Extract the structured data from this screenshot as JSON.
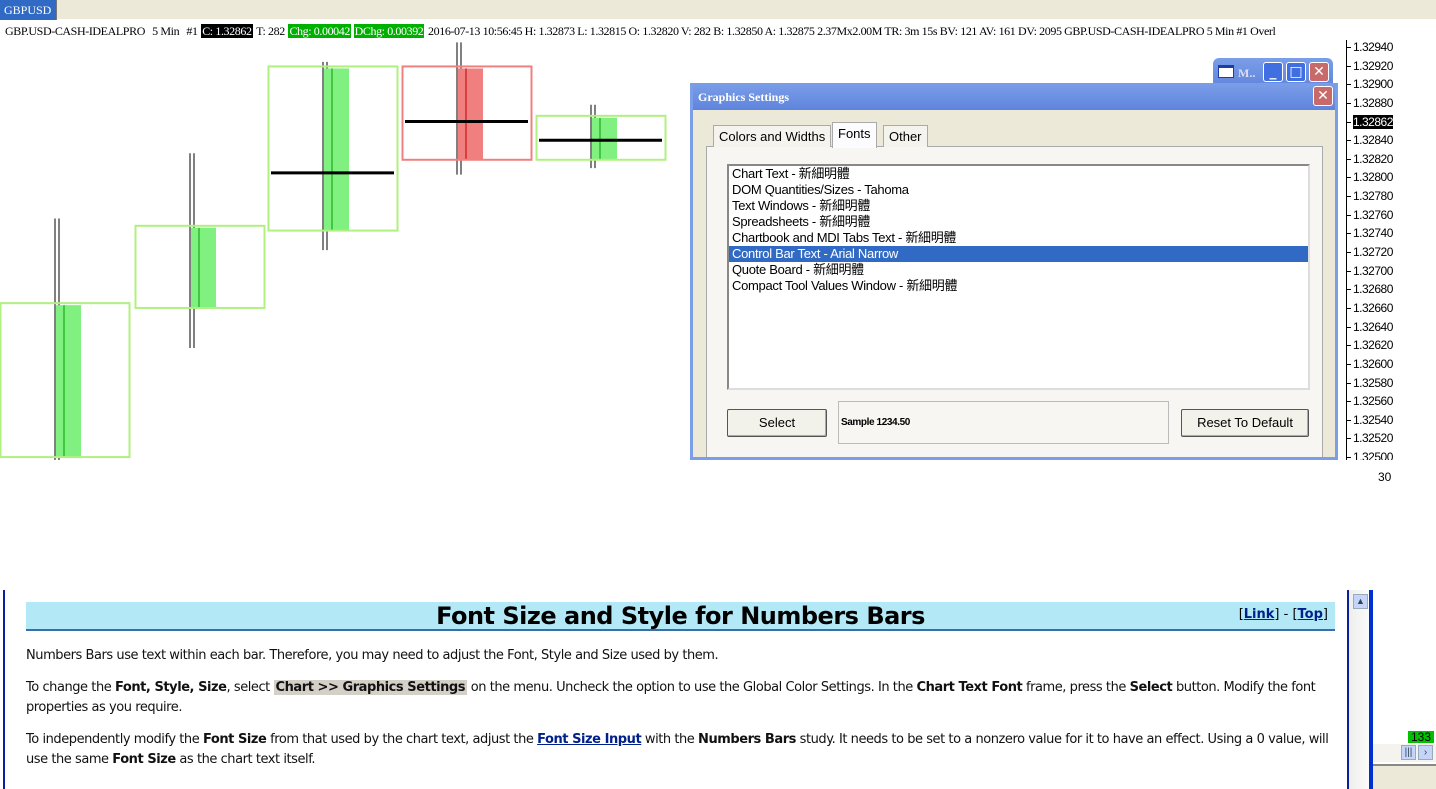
{
  "tab": {
    "label": "GBPUSD"
  },
  "info": {
    "symbol": "GBP.USD-CASH-IDEALPRO",
    "interval": "5 Min",
    "num": "#1",
    "close": "C: 1.32862",
    "ticks": "T: 282",
    "chg": "Chg: 0.00042",
    "dchg": "DChg: 0.00392",
    "rest": "2016-07-13 10:56:45 H: 1.32873 L: 1.32815 O: 1.32820 V: 282 B: 1.32850 A: 1.32875 2.37Mx2.00M TR: 3m 15s BV: 121 AV: 161 DV: 2095  GBP.USD-CASH-IDEALPRO  5 Min  #1 Overl"
  },
  "chart": {
    "price_ticks": [
      "1.32940",
      "1.32920",
      "1.32900",
      "1.32880",
      "1.32862",
      "1.32840",
      "1.32820",
      "1.32800",
      "1.32780",
      "1.32760",
      "1.32740",
      "1.32720",
      "1.32700",
      "1.32680",
      "1.32660",
      "1.32640",
      "1.32620",
      "1.32600",
      "1.32580",
      "1.32560",
      "1.32540",
      "1.32520",
      "1.32500"
    ],
    "current_price": "1.32862",
    "volume_label": "30",
    "candles": [
      {
        "open": 1.325,
        "high": 1.32756,
        "low": 1.3248,
        "close": 1.32663,
        "poc": null
      },
      {
        "open": 1.3266,
        "high": 1.32826,
        "low": 1.32617,
        "close": 1.32746,
        "poc": null
      },
      {
        "open": 1.32743,
        "high": 1.32924,
        "low": 1.32722,
        "close": 1.32917,
        "poc": 1.32805
      },
      {
        "open": 1.32917,
        "high": 1.32945,
        "low": 1.32803,
        "close": 1.32819,
        "poc": 1.3286
      },
      {
        "open": 1.32819,
        "high": 1.32878,
        "low": 1.3281,
        "close": 1.32864,
        "poc": 1.3284
      }
    ],
    "colors": {
      "up": "#80f080",
      "down": "#f08080",
      "up_box": "#b0f080",
      "down_box": "#f08080"
    }
  },
  "back_window": {
    "title": "M.."
  },
  "dialog": {
    "title": "Graphics Settings",
    "tabs": [
      "Colors and Widths",
      "Fonts",
      "Other"
    ],
    "active_tab": "Fonts",
    "font_items": [
      "Chart Text - 新細明體",
      "DOM Quantities/Sizes - Tahoma",
      "Text Windows - 新細明體",
      "Spreadsheets - 新細明體",
      "Chartbook and MDI Tabs Text - 新細明體",
      "Control Bar Text - Arial Narrow",
      "Quote Board - 新細明體",
      "Compact Tool Values Window - 新細明體"
    ],
    "selected_item": "Control Bar Text - Arial Narrow",
    "select_label": "Select",
    "sample_text": "Sample 1234.50",
    "reset_label": "Reset To Default"
  },
  "doc": {
    "title": "Font Size and Style for Numbers Bars",
    "link": "Link",
    "sep": " - ",
    "top": "Top",
    "p1": "Numbers Bars use text within each bar. Therefore, you may need to adjust the Font, Style and Size used by them.",
    "p2": {
      "a": "To change the ",
      "b1": "Font, Style, Size",
      "c": ", select ",
      "code": "Chart >> Graphics Settings",
      "d": " on the menu. Uncheck the option to use the Global Color Settings. In the ",
      "b2": "Chart Text Font",
      "e": " frame, press the ",
      "b3": "Select",
      "f": " button. Modify the font properties as you require."
    },
    "p3": {
      "a": "To independently modify the ",
      "b1": "Font Size",
      "c": " from that used by the chart text, adjust the ",
      "link": "Font Size Input",
      "d": " with the ",
      "b2": "Numbers Bars",
      "e": " study. It needs to be set to a nonzero value for it to have an effect. Using a 0 value, will use the same ",
      "b3": "Font Size",
      "f": " as the chart text itself."
    }
  },
  "side": {
    "badge": "133"
  }
}
